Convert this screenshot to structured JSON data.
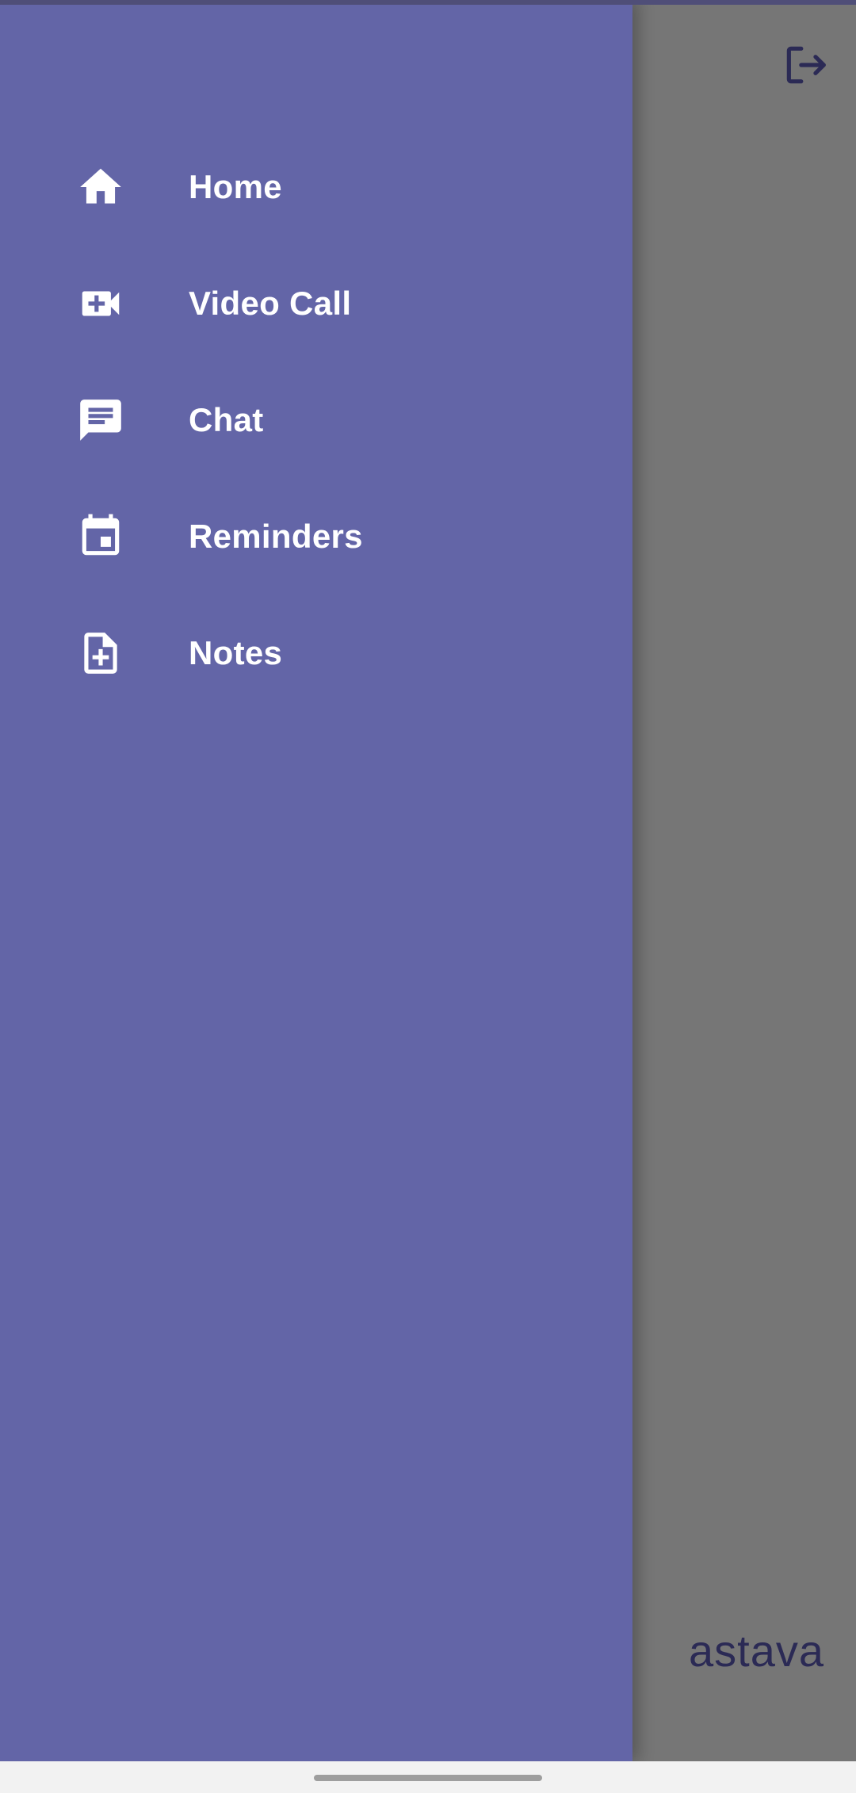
{
  "drawer": {
    "background": "#6365a7",
    "items": [
      {
        "label": "Home",
        "icon": "home-icon"
      },
      {
        "label": "Video Call",
        "icon": "video-call-icon"
      },
      {
        "label": "Chat",
        "icon": "chat-icon"
      },
      {
        "label": "Reminders",
        "icon": "calendar-icon"
      },
      {
        "label": "Notes",
        "icon": "note-add-icon"
      }
    ]
  },
  "underlay": {
    "logout_icon": "logout-icon",
    "partial_text": "astava",
    "scrim_color": "#767676"
  },
  "colors": {
    "accent": "#6365a7",
    "text_on_accent": "#ffffff",
    "underlay_text": "#2b2a55"
  }
}
